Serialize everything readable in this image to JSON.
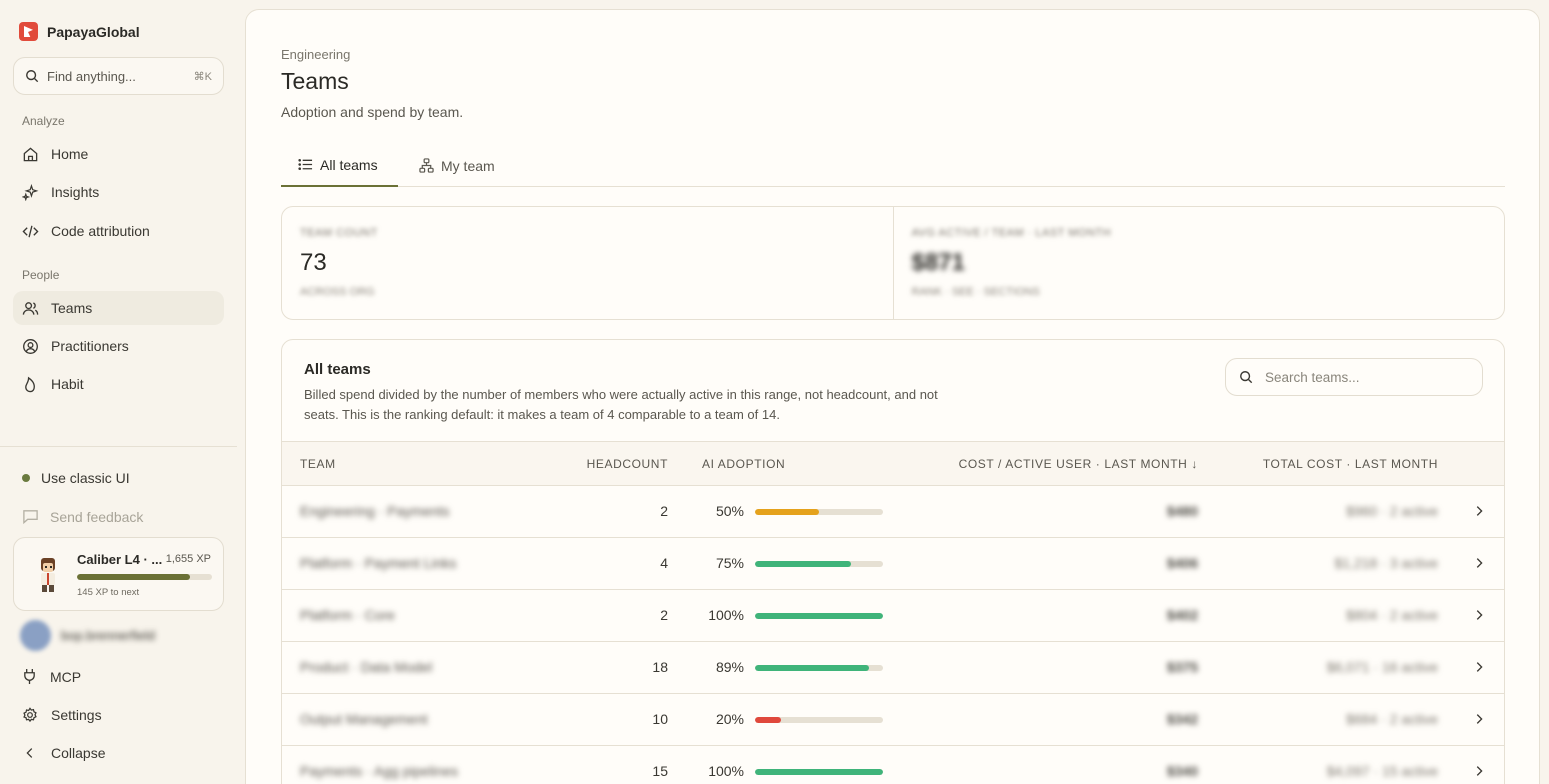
{
  "brand": {
    "name": "PapayaGlobal"
  },
  "search": {
    "placeholder": "Find anything...",
    "shortcut": "⌘K"
  },
  "sidebar": {
    "section_analyze": "Analyze",
    "section_people": "People",
    "items": [
      {
        "label": "Home",
        "icon": "home-icon"
      },
      {
        "label": "Insights",
        "icon": "sparkles-icon"
      },
      {
        "label": "Code attribution",
        "icon": "code-icon"
      },
      {
        "label": "Teams",
        "icon": "users-icon",
        "active": true
      },
      {
        "label": "Practitioners",
        "icon": "user-circle-icon"
      },
      {
        "label": "Habit",
        "icon": "flame-icon"
      }
    ],
    "classic_ui": "Use classic UI",
    "feedback": "Send feedback",
    "xp": {
      "title": "Caliber L4 · ...",
      "value": "1,655 XP",
      "next": "145 XP to next",
      "progress": 0.84
    },
    "user_name": "bop.brennerfield",
    "bottom": [
      {
        "label": "MCP",
        "icon": "plug-icon"
      },
      {
        "label": "Settings",
        "icon": "gear-icon"
      },
      {
        "label": "Collapse",
        "icon": "chevron-left-icon"
      }
    ]
  },
  "page": {
    "breadcrumb": "Engineering",
    "title": "Teams",
    "subtitle": "Adoption and spend by team."
  },
  "tabs": [
    {
      "label": "All teams",
      "icon": "list-icon",
      "active": true
    },
    {
      "label": "My team",
      "icon": "org-icon",
      "active": false
    }
  ],
  "stats": [
    {
      "label": "TEAM COUNT",
      "value": "73",
      "note": "ACROSS ORG"
    },
    {
      "label": "AVG ACTIVE / TEAM · LAST MONTH",
      "value": "$871",
      "note": "RANK · SEE · SECTIONS"
    }
  ],
  "table": {
    "title": "All teams",
    "description": "Billed spend divided by the number of members who were actually active in this range, not headcount, and not seats. This is the ranking default: it makes a team of 4 comparable to a team of 14.",
    "search_placeholder": "Search teams...",
    "columns": {
      "team": "TEAM",
      "headcount": "HEADCOUNT",
      "adoption": "AI ADOPTION",
      "cost_per_user": "COST / ACTIVE USER · LAST MONTH ↓",
      "total_cost": "TOTAL COST · LAST MONTH"
    },
    "rows": [
      {
        "team": "Engineering · Payments",
        "headcount": "2",
        "adoption_label": "50%",
        "adoption": 0.5,
        "color": "#e5a21c",
        "cost": "$480",
        "total": "$960 · 2 active"
      },
      {
        "team": "Platform · Payment Links",
        "headcount": "4",
        "adoption_label": "75%",
        "adoption": 0.75,
        "color": "#3fb47a",
        "cost": "$406",
        "total": "$1,218 · 3 active"
      },
      {
        "team": "Platform · Core",
        "headcount": "2",
        "adoption_label": "100%",
        "adoption": 1.0,
        "color": "#3fb47a",
        "cost": "$402",
        "total": "$804 · 2 active"
      },
      {
        "team": "Product · Data Model",
        "headcount": "18",
        "adoption_label": "89%",
        "adoption": 0.89,
        "color": "#3fb47a",
        "cost": "$375",
        "total": "$6,071 · 16 active"
      },
      {
        "team": "Output Management",
        "headcount": "10",
        "adoption_label": "20%",
        "adoption": 0.2,
        "color": "#e0483c",
        "cost": "$342",
        "total": "$684 · 2 active"
      },
      {
        "team": "Payments · Agg pipelines",
        "headcount": "15",
        "adoption_label": "100%",
        "adoption": 1.0,
        "color": "#3fb47a",
        "cost": "$340",
        "total": "$4,097 · 15 active"
      }
    ]
  }
}
